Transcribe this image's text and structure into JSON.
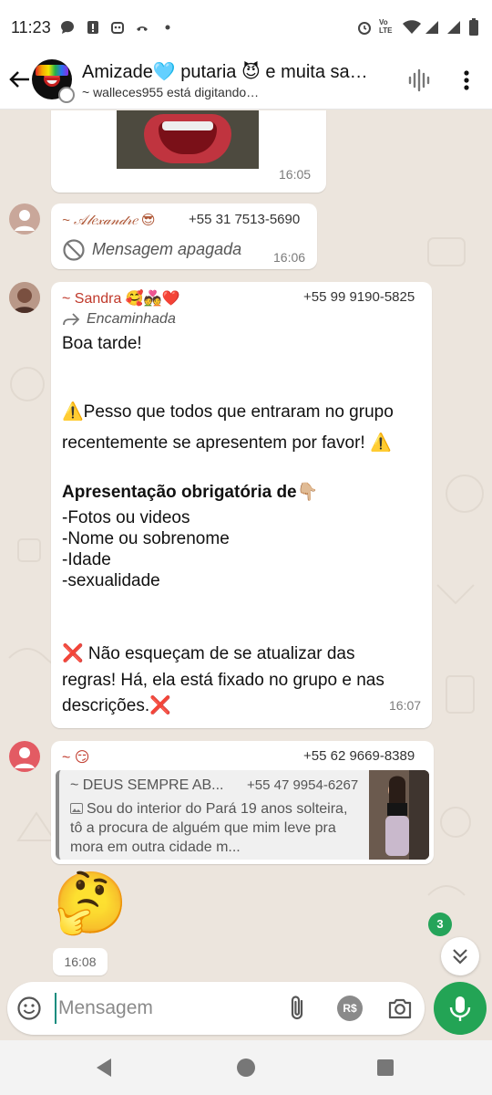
{
  "status_bar": {
    "time": "11:23",
    "icons": [
      "chat-bubble-icon",
      "alert-icon",
      "robot-icon",
      "missed-call-icon",
      "dot-icon",
      "alarm-icon",
      "volte-icon",
      "wifi-icon",
      "signal-icon",
      "signal-icon",
      "battery-icon"
    ],
    "volte_label": "Vo LTE"
  },
  "header": {
    "title": "Amizade🩵 putaria 😈 e muita sa…",
    "typing_status": "~ walleces955 está digitando…"
  },
  "messages": [
    {
      "type": "image",
      "time": "16:05"
    },
    {
      "type": "deleted",
      "sender": "~ 𝒜𝓁𝑒𝓍𝒶𝓃𝒹𝓇𝑒 😎",
      "phone": "+55 31 7513-5690",
      "text": "Mensagem apagada",
      "time": "16:06"
    },
    {
      "type": "text",
      "sender": "~ Sandra 🥰💑❤️",
      "phone": "+55 99 9190-5825",
      "forwarded": "Encaminhada",
      "lines": {
        "l1": "Boa tarde!",
        "l2": "⚠️Pesso que todos que entraram no grupo",
        "l3": "recentemente se apresentem por favor! ⚠️",
        "l4": "Apresentação obrigatória de👇🏼",
        "l5": "-Fotos ou videos",
        "l6": "-Nome ou sobrenome",
        "l7": "-Idade",
        "l8": "-sexualidade",
        "l9": "❌ Não esqueçam de se atualizar das",
        "l10": "regras!  Há, ela está fixado no grupo e nas",
        "l11": "descrições.❌"
      },
      "time": "16:07"
    },
    {
      "type": "reply",
      "sender": "~ 😏",
      "phone": "+55 62 9669-8389",
      "quote": {
        "sender": "~ DEUS SEMPRE AB...",
        "phone": "+55 47 9954-6267",
        "text": "Sou do interior do Pará 19 anos solteira, tô a procura de alguém que mim leve pra mora em outra cidade m..."
      }
    },
    {
      "type": "sticker",
      "emoji": "🤔",
      "time": "16:08"
    }
  ],
  "unread_count": "3",
  "composer": {
    "placeholder": "Mensagem",
    "pay_label": "R$"
  },
  "colors": {
    "chat_background": "#ece5dd",
    "sender_name": "#c0392b",
    "accent_green": "#23a455",
    "bubble": "#ffffff"
  }
}
